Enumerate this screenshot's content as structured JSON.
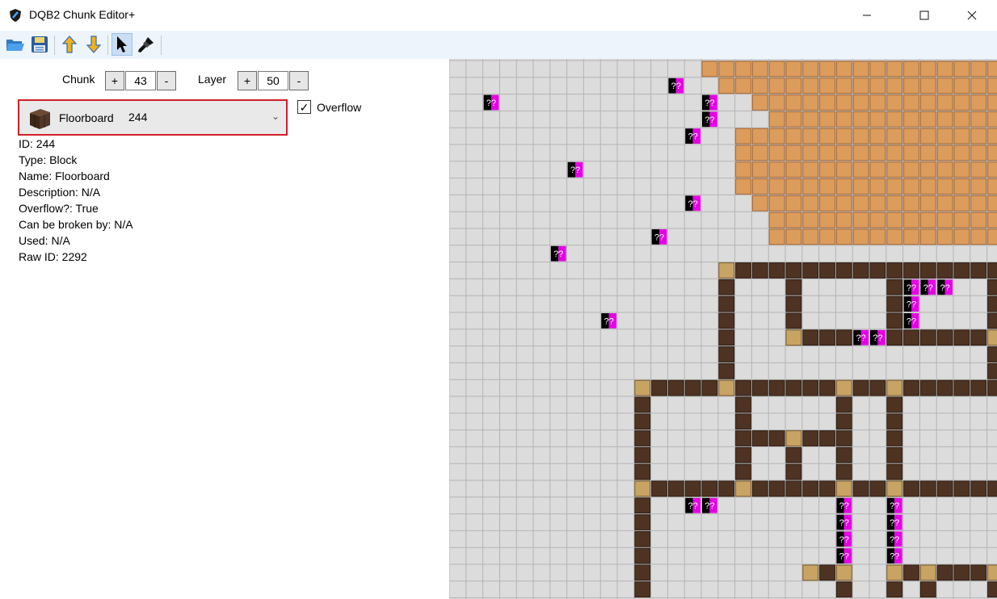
{
  "window": {
    "title": "DQB2 Chunk Editor+",
    "icons": [
      "app-icon",
      "minimize-icon",
      "maximize-icon",
      "close-icon"
    ]
  },
  "toolbar": {
    "buttons": [
      "open-folder-icon",
      "save-icon",
      "layer-up-icon",
      "layer-down-icon",
      "select-pointer-icon",
      "brush-icon"
    ],
    "active_tool": "select-pointer-icon"
  },
  "chunk": {
    "label": "Chunk",
    "value": "43",
    "plus": "+",
    "minus": "-"
  },
  "layer": {
    "label": "Layer",
    "value": "50",
    "plus": "+",
    "minus": "-"
  },
  "block_select": {
    "name": "Floorboard",
    "number": "244",
    "icon": "floorboard-block-icon",
    "arrow": "⌄"
  },
  "overflow": {
    "label": "Overflow",
    "checked": "✓"
  },
  "info": {
    "id": "ID: 244",
    "type": "Type: Block",
    "name": "Name: Floorboard",
    "description": "Description: N/A",
    "overflow": "Overflow?: True",
    "broken_by": "Can be broken by: N/A",
    "used": "Used: N/A",
    "raw_id": "Raw ID: 2292"
  },
  "map": {
    "unknown_label": "??",
    "colors": {
      "empty": "#dcdcdc",
      "gridline": "#b4b4b4",
      "orange_block": "#dc9c5c",
      "dark_wood": "#4e3323",
      "light_wood": "#c8a464",
      "unknown_magenta": "#e600e6",
      "unknown_black": "#000000"
    }
  }
}
